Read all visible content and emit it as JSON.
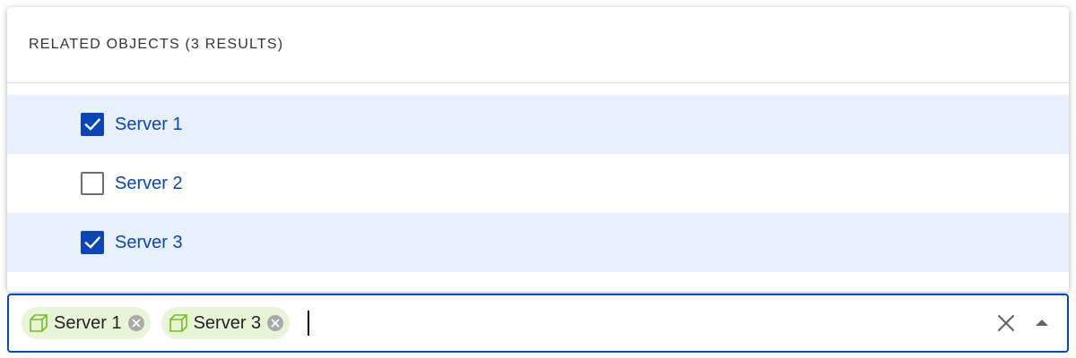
{
  "dropdown": {
    "header": "RELATED OBJECTS (3 RESULTS)",
    "options": [
      {
        "label": "Server 1",
        "checked": true
      },
      {
        "label": "Server 2",
        "checked": false
      },
      {
        "label": "Server 3",
        "checked": true
      }
    ]
  },
  "input": {
    "chips": [
      {
        "label": "Server 1",
        "icon": "cube-icon"
      },
      {
        "label": "Server 3",
        "icon": "cube-icon"
      }
    ],
    "value": "",
    "clear_icon": "close-icon",
    "toggle_icon": "triangle-up-icon"
  },
  "colors": {
    "accent": "#0b45b6",
    "selected_row": "#e8f0fb",
    "chip_bg": "#e9f3d8",
    "chip_icon": "#6fbf1f",
    "unchecked_border": "#6f6f6f"
  }
}
